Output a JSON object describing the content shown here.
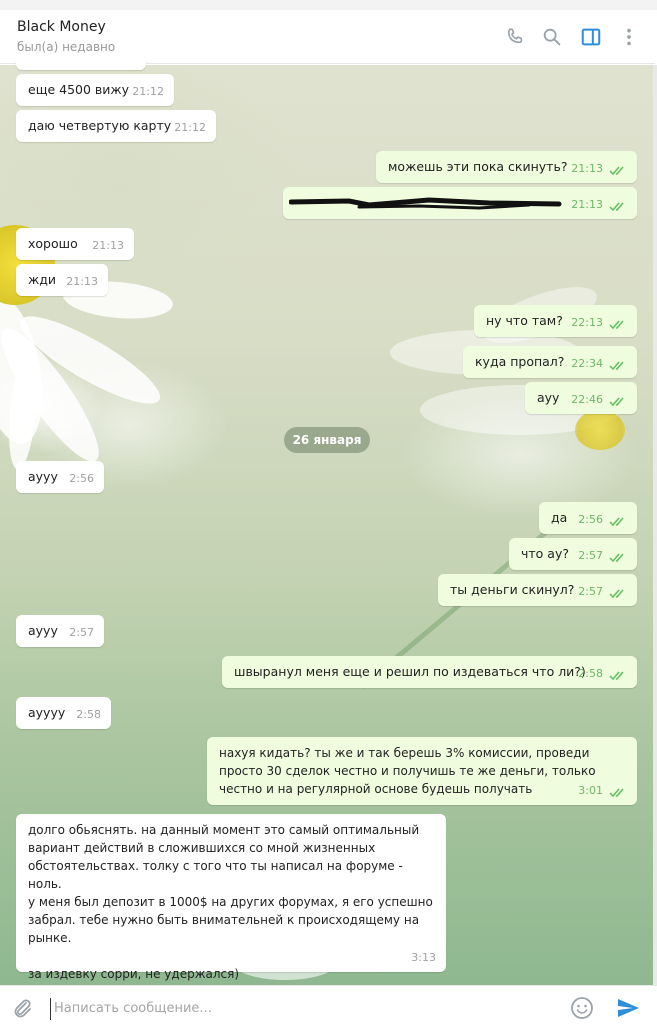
{
  "header": {
    "name": "Black Money",
    "status": "был(а) недавно",
    "icons": [
      "phone-icon",
      "search-icon",
      "sidebar-toggle-icon",
      "more-vert-icon"
    ]
  },
  "messages": {
    "m1": {
      "text": "еще 4500 вижу",
      "time": "21:12"
    },
    "m2": {
      "text": "даю четвертую карту",
      "time": "21:12"
    },
    "m3": {
      "text": "можешь эти пока скинуть?",
      "time": "21:13"
    },
    "m4": {
      "text": "",
      "time": "21:13"
    },
    "m5": {
      "text": "хорошо",
      "time": "21:13"
    },
    "m6": {
      "text": "жди",
      "time": "21:13"
    },
    "m7": {
      "text": "ну что там?",
      "time": "22:13"
    },
    "m8": {
      "text": "куда пропал?",
      "time": "22:34"
    },
    "m9": {
      "text": "ауу",
      "time": "22:46"
    },
    "date": "26 января",
    "m10": {
      "text": "аууу",
      "time": "2:56"
    },
    "m11": {
      "text": "да",
      "time": "2:56"
    },
    "m12": {
      "text": "что ау?",
      "time": "2:57"
    },
    "m13": {
      "text": "ты деньги скинул?",
      "time": "2:57"
    },
    "m14": {
      "text": "аууу",
      "time": "2:57"
    },
    "m15": {
      "text": "швыранул меня еще и решил по издеваться что ли?)",
      "time": "2:58"
    },
    "m16": {
      "text": "ауууу",
      "time": "2:58"
    },
    "m17": {
      "text": "нахуя кидать? ты же и так берешь 3% комиссии, проведи\nпросто 30 сделок честно и получишь те же деньги, только\nчестно и на регулярной основе будешь получать",
      "time": "3:01"
    },
    "m18": {
      "text": "долго обьяснять. на данный момент это самый оптимальный\nвариант действий в сложившихся со мной жизненных\nобстоятельствах. толку с того что ты написал на форуме - ноль.\nу меня был депозит в 1000$ на других форумах, я его успешно\nзабрал. тебе нужно быть внимательней к происходящему на\nрынке.\n\nза издевку сорри, не удержался)",
      "time": "3:13"
    }
  },
  "composer": {
    "placeholder": "Написать сообщение...",
    "icons": [
      "attach-icon",
      "emoji-icon",
      "send-icon"
    ]
  },
  "colors": {
    "outgoing_bubble": "#effdde",
    "incoming_bubble": "#ffffff",
    "check_green": "#5fbf5f",
    "accent_blue": "#2f8ed8"
  }
}
